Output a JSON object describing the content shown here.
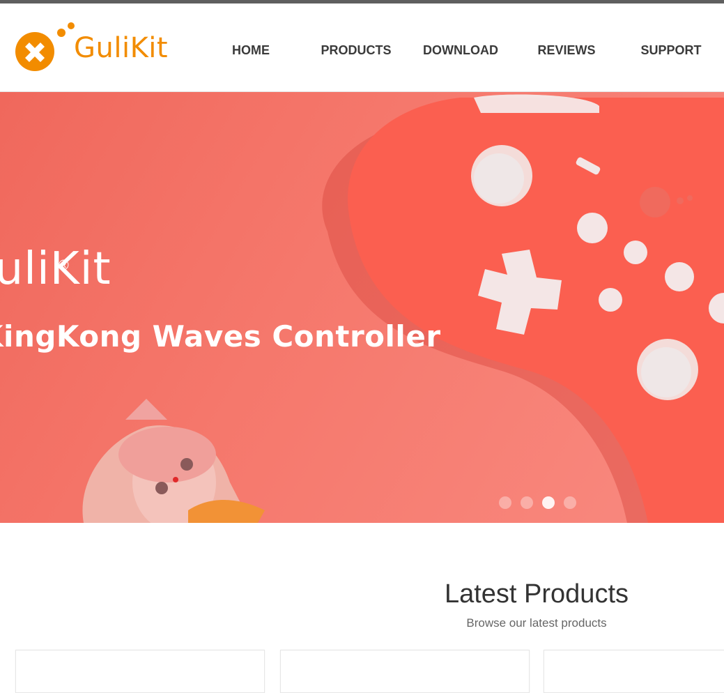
{
  "brand": {
    "name": "GuliKit",
    "accent_color": "#f28c00",
    "logo_icon": "gamepad-logo-icon"
  },
  "nav": {
    "items": [
      {
        "label": "HOME"
      },
      {
        "label": "PRODUCTS"
      },
      {
        "label": "DOWNLOAD"
      },
      {
        "label": "REVIEWS"
      },
      {
        "label": "SUPPORT"
      }
    ]
  },
  "hero": {
    "brand_text": "GuliKit",
    "registered_mark": "®",
    "tagline": "KingKong Waves Controller",
    "background_color": "#f5776b",
    "slides_count": 4,
    "active_slide": 3
  },
  "latest_products": {
    "title": "Latest Products",
    "subtitle": "Browse our latest products"
  }
}
